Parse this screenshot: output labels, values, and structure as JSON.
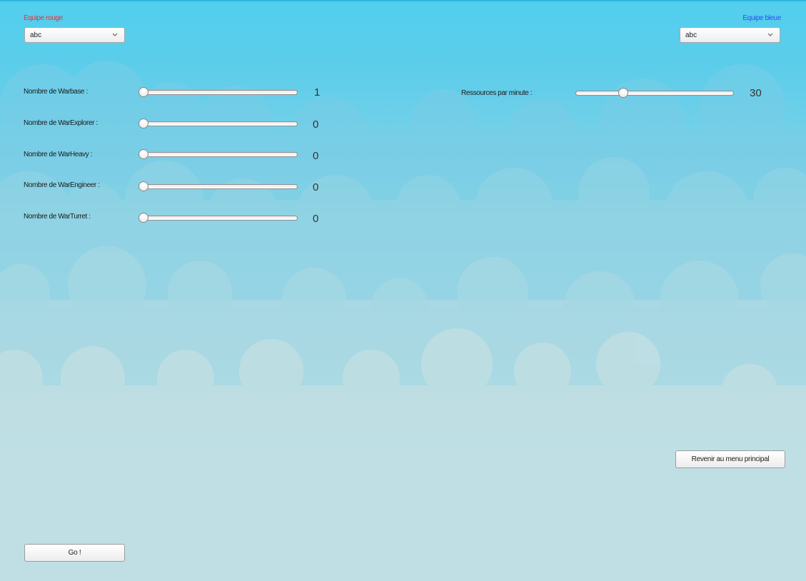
{
  "teams": {
    "red": {
      "label": "Equipe rouge",
      "selected": "abc",
      "color": "#e0343c"
    },
    "blue": {
      "label": "Equipe bleue",
      "selected": "abc",
      "color": "#2f4cf0"
    }
  },
  "units": [
    {
      "label": "Nombre de Warbase :",
      "value": "1"
    },
    {
      "label": "Nombre de WarExplorer :",
      "value": "0"
    },
    {
      "label": "Nombre de WarHeavy :",
      "value": "0"
    },
    {
      "label": "Nombre de WarEngineer :",
      "value": "0"
    },
    {
      "label": "Nombre de WarTurret :",
      "value": "0"
    }
  ],
  "resources": {
    "label": "Ressources par minute :",
    "value": "30"
  },
  "buttons": {
    "back": "Revenir au menu principal",
    "go": "Go !"
  },
  "icons": {
    "dropdown": "chevron-down-icon"
  },
  "colors": {
    "sky": "#52cfee",
    "cloud": "#bfdfe4"
  }
}
